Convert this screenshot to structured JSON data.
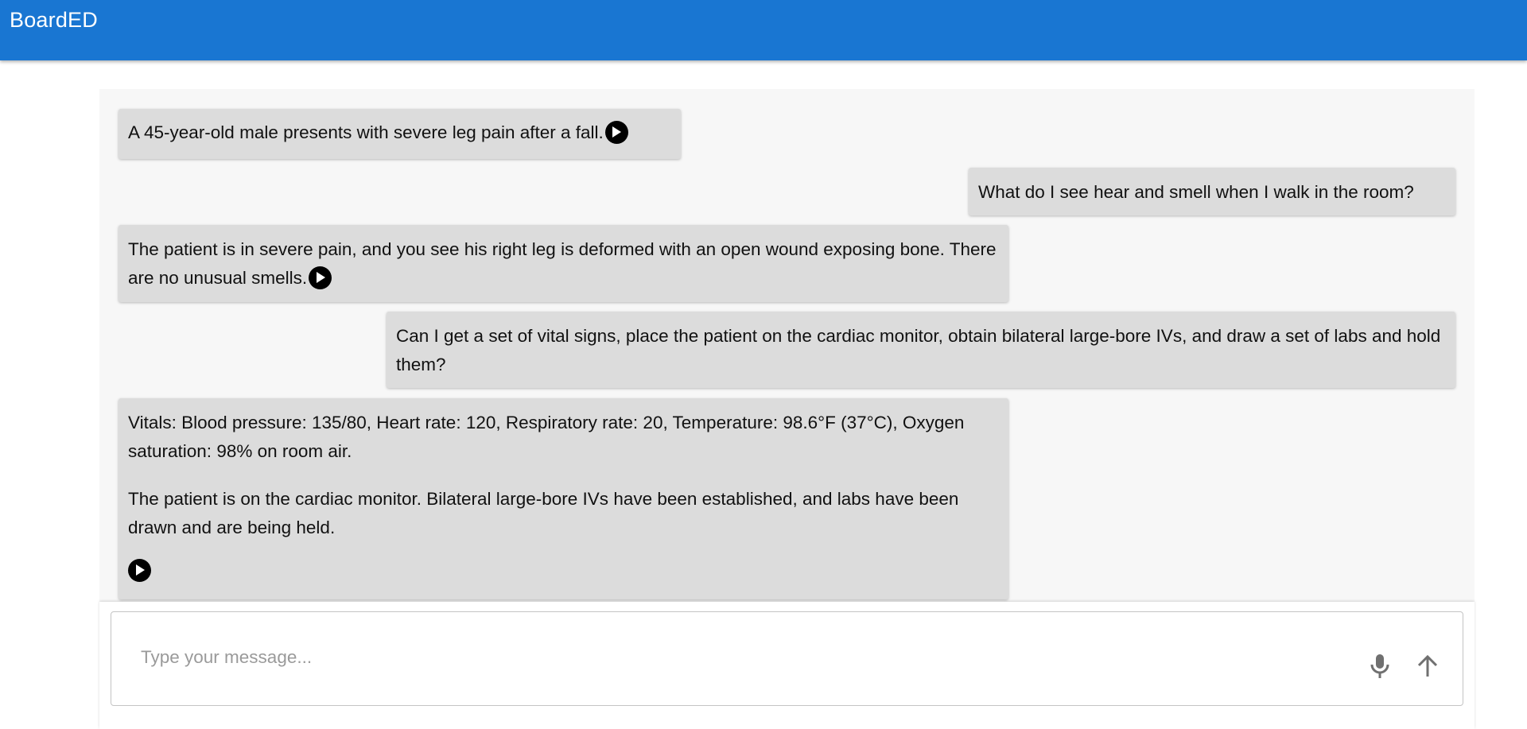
{
  "app": {
    "title": "BoardED"
  },
  "messages": [
    {
      "role": "assistant",
      "paragraphs": [
        "A 45-year-old male presents with severe leg pain after a fall."
      ]
    },
    {
      "role": "user",
      "paragraphs": [
        "What do I see hear and smell when I walk in the room?"
      ]
    },
    {
      "role": "assistant",
      "paragraphs": [
        "The patient is in severe pain, and you see his right leg is deformed with an open wound exposing bone. There are no unusual smells."
      ]
    },
    {
      "role": "user",
      "paragraphs": [
        "Can I get a set of vital signs, place the patient on the cardiac monitor, obtain bilateral large-bore IVs, and draw a set of labs and hold them?"
      ]
    },
    {
      "role": "assistant",
      "paragraphs": [
        "Vitals: Blood pressure: 135/80, Heart rate: 120, Respiratory rate: 20, Temperature: 98.6°F (37°C), Oxygen saturation: 98% on room air.",
        "The patient is on the cardiac monitor. Bilateral large-bore IVs have been established, and labs have been drawn and are being held."
      ]
    }
  ],
  "composer": {
    "placeholder": "Type your message...",
    "value": "",
    "mic_icon": "microphone-icon",
    "send_icon": "arrow-up-icon"
  },
  "colors": {
    "appbar": "#1976d2",
    "bubble": "#dcdcdc",
    "panel": "#f7f7f7"
  }
}
